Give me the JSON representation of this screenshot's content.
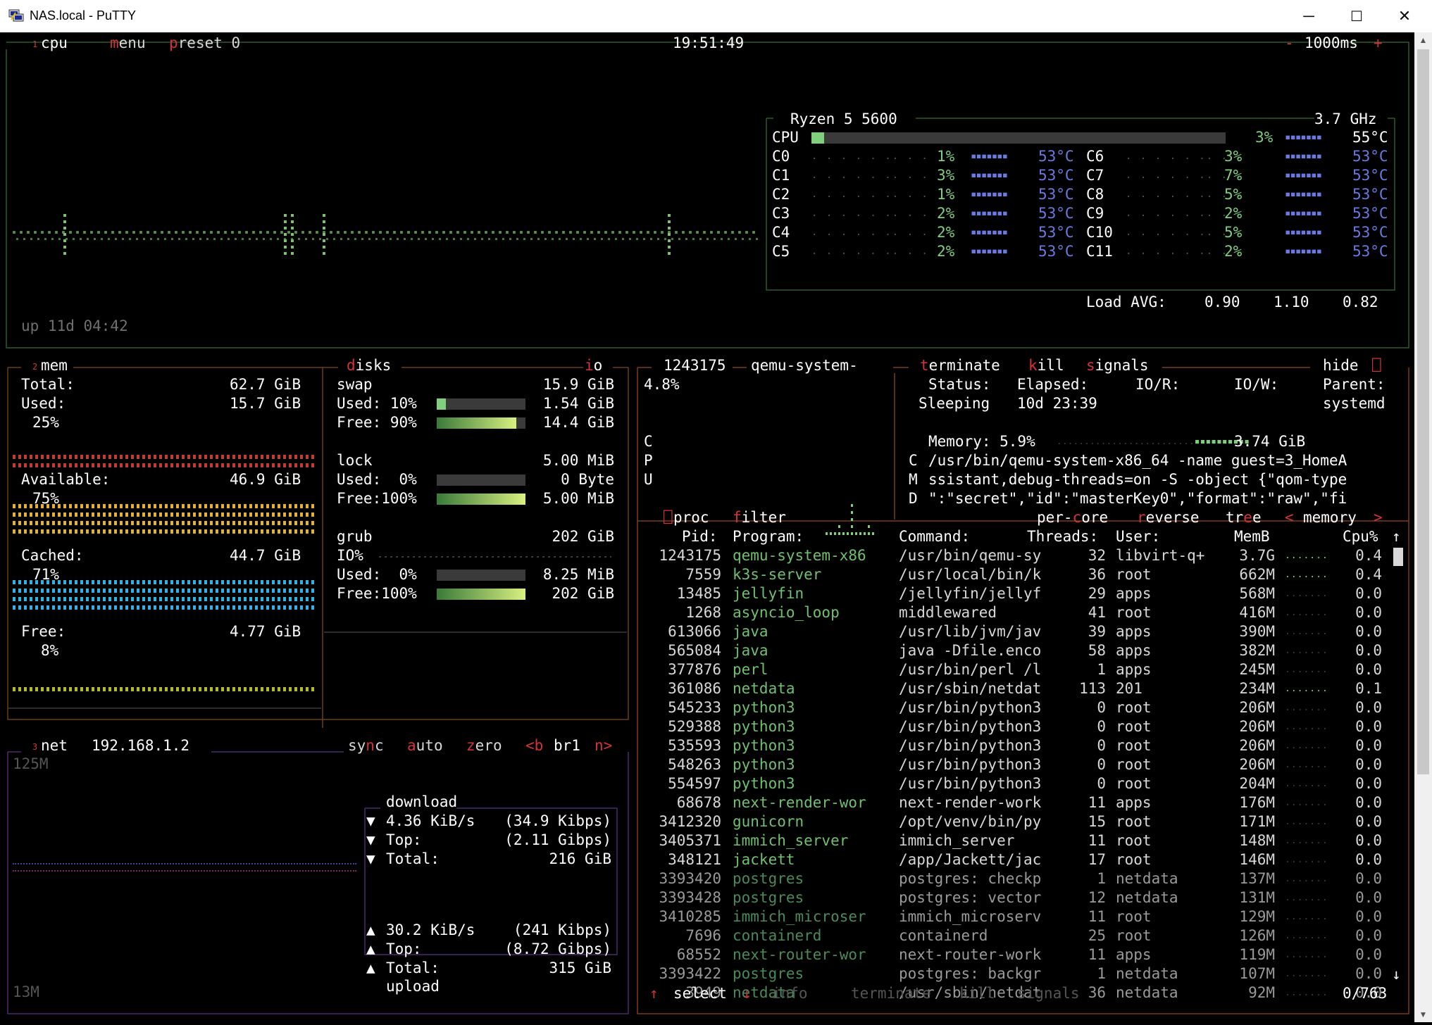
{
  "window": {
    "title": "NAS.local - PuTTY",
    "minimize": "─",
    "maximize": "☐",
    "close": "✕"
  },
  "cpu_box": {
    "num": "1",
    "tab": "cpu",
    "menu": "menu",
    "preset": "preset 0",
    "clock": "19:51:49",
    "minus": "-",
    "interval": "1000ms",
    "plus": "+",
    "uptime": "up 11d 04:42",
    "model": "Ryzen 5 5600",
    "freq": "3.7 GHz",
    "total": {
      "label": "CPU",
      "usage_fraction": 0.03,
      "pct": "3%",
      "temp": "55°C"
    },
    "cores": [
      {
        "label": "C0",
        "pct": "1%",
        "temp": "53°C"
      },
      {
        "label": "C1",
        "pct": "3%",
        "temp": "53°C"
      },
      {
        "label": "C2",
        "pct": "1%",
        "temp": "53°C"
      },
      {
        "label": "C3",
        "pct": "2%",
        "temp": "53°C"
      },
      {
        "label": "C4",
        "pct": "2%",
        "temp": "53°C"
      },
      {
        "label": "C5",
        "pct": "2%",
        "temp": "53°C"
      },
      {
        "label": "C6",
        "pct": "3%",
        "temp": "53°C"
      },
      {
        "label": "C7",
        "pct": "7%",
        "temp": "53°C"
      },
      {
        "label": "C8",
        "pct": "5%",
        "temp": "53°C"
      },
      {
        "label": "C9",
        "pct": "2%",
        "temp": "53°C"
      },
      {
        "label": "C10",
        "pct": "5%",
        "temp": "53°C"
      },
      {
        "label": "C11",
        "pct": "2%",
        "temp": "53°C"
      }
    ],
    "load_label": "Load AVG:",
    "load": [
      "0.90",
      "1.10",
      "0.82"
    ]
  },
  "mem_box": {
    "num": "2",
    "tab": "mem",
    "total_label": "Total:",
    "total": "62.7 GiB",
    "used_label": "Used:",
    "used": "15.7 GiB",
    "used_pct": "25%",
    "avail_label": "Available:",
    "avail": "46.9 GiB",
    "avail_pct": "75%",
    "cached_label": "Cached:",
    "cached": "44.7 GiB",
    "cached_pct": "71%",
    "free_label": "Free:",
    "free": "4.77 GiB",
    "free_pct": "8%"
  },
  "disks_box": {
    "tab": "disks",
    "io_tab": "io",
    "disks": [
      {
        "name": "swap",
        "size": "15.9 GiB",
        "used_label": "Used: 10%",
        "used": "1.54 GiB",
        "used_fraction": 0.1,
        "free_label": "Free: 90%",
        "free": "14.4 GiB",
        "free_fraction": 0.9
      },
      {
        "name": "lock",
        "size": "5.00 MiB",
        "used_label": "Used:  0%",
        "used": "0 Byte",
        "used_fraction": 0.0,
        "free_label": "Free:100%",
        "free": "5.00 MiB",
        "free_fraction": 1.0
      },
      {
        "name": "grub",
        "size": "202 GiB",
        "io_label": "IO%",
        "used_label": "Used:  0%",
        "used": "8.25 MiB",
        "used_fraction": 0.0,
        "free_label": "Free:100%",
        "free": "202 GiB",
        "free_fraction": 1.0
      }
    ]
  },
  "net_box": {
    "num": "3",
    "tab": "net",
    "ip": "192.168.1.2",
    "sync": "sync",
    "auto": "auto",
    "zero": "zero",
    "b_key": "<b",
    "iface": "br1",
    "n_key": "n>",
    "scale_top": "125M",
    "scale_bottom": "13M",
    "download_title": "download",
    "upload_title": "upload",
    "download": [
      {
        "icon": "▼",
        "label": "4.36 KiB/s",
        "value": "(34.9 Kibps)"
      },
      {
        "icon": "▼",
        "label": "Top:",
        "value": "(2.11 Gibps)"
      },
      {
        "icon": "▼",
        "label": "Total:",
        "value": "216 GiB"
      }
    ],
    "upload": [
      {
        "icon": "▲",
        "label": "30.2 KiB/s",
        "value": "(241 Kibps)"
      },
      {
        "icon": "▲",
        "label": "Top:",
        "value": "(8.72 Gibps)"
      },
      {
        "icon": "▲",
        "label": "Total:",
        "value": "315 GiB"
      }
    ]
  },
  "detail_box": {
    "pid": "1243175",
    "name": "qemu-system-",
    "terminate": "terminate",
    "kill": "kill",
    "signals": "signals",
    "hide": "hide",
    "cpu_pct": "4.8%",
    "cpu_vlabel": [
      "C",
      "P",
      "U"
    ],
    "status_label": "Status:",
    "status": "Sleeping",
    "elapsed_label": "Elapsed:",
    "elapsed": "10d 23:39",
    "ior_label": "IO/R:",
    "iow_label": "IO/W:",
    "parent_label": "Parent:",
    "parent": "systemd",
    "memory_label": "Memory: 5.9%",
    "memory": "3.74 GiB",
    "cmd_vlabel": [
      "C",
      "M",
      "D"
    ],
    "cmd_lines": [
      "/usr/bin/qemu-system-x86_64 -name guest=3_HomeA",
      "ssistant,debug-threads=on -S -object {\"qom-type",
      "\":\"secret\",\"id\":\"masterKey0\",\"format\":\"raw\",\"fi"
    ]
  },
  "proc_box": {
    "tab": "proc",
    "filter": "filter",
    "per_core": "per-core",
    "reverse": "reverse",
    "tree": "tree",
    "sort": "memory",
    "sort_left": "<",
    "sort_right": ">",
    "headers": {
      "pid": "Pid:",
      "program": "Program:",
      "command": "Command:",
      "threads": "Threads:",
      "user": "User:",
      "memb": "MemB",
      "cpu": "Cpu%"
    },
    "rows": [
      {
        "pid": "1243175",
        "program": "qemu-system-x86",
        "command": "/usr/bin/qemu-sy",
        "threads": "32",
        "user": "libvirt-q+",
        "mem": "3.7G",
        "cpu": "0.4"
      },
      {
        "pid": "7559",
        "program": "k3s-server",
        "command": "/usr/local/bin/k",
        "threads": "36",
        "user": "root",
        "mem": "662M",
        "cpu": "0.4"
      },
      {
        "pid": "13485",
        "program": "jellyfin",
        "command": "/jellyfin/jellyf",
        "threads": "29",
        "user": "apps",
        "mem": "568M",
        "cpu": "0.0"
      },
      {
        "pid": "1268",
        "program": "asyncio_loop",
        "command": "middlewared",
        "threads": "41",
        "user": "root",
        "mem": "416M",
        "cpu": "0.0"
      },
      {
        "pid": "613066",
        "program": "java",
        "command": "/usr/lib/jvm/jav",
        "threads": "39",
        "user": "apps",
        "mem": "390M",
        "cpu": "0.0"
      },
      {
        "pid": "565084",
        "program": "java",
        "command": "java -Dfile.enco",
        "threads": "58",
        "user": "apps",
        "mem": "382M",
        "cpu": "0.0"
      },
      {
        "pid": "377876",
        "program": "perl",
        "command": "/usr/bin/perl /l",
        "threads": "1",
        "user": "apps",
        "mem": "245M",
        "cpu": "0.0"
      },
      {
        "pid": "361086",
        "program": "netdata",
        "command": "/usr/sbin/netdat",
        "threads": "113",
        "user": "201",
        "mem": "234M",
        "cpu": "0.1"
      },
      {
        "pid": "545233",
        "program": "python3",
        "command": "/usr/bin/python3",
        "threads": "0",
        "user": "root",
        "mem": "206M",
        "cpu": "0.0"
      },
      {
        "pid": "529388",
        "program": "python3",
        "command": "/usr/bin/python3",
        "threads": "0",
        "user": "root",
        "mem": "206M",
        "cpu": "0.0"
      },
      {
        "pid": "535593",
        "program": "python3",
        "command": "/usr/bin/python3",
        "threads": "0",
        "user": "root",
        "mem": "206M",
        "cpu": "0.0"
      },
      {
        "pid": "548263",
        "program": "python3",
        "command": "/usr/bin/python3",
        "threads": "0",
        "user": "root",
        "mem": "206M",
        "cpu": "0.0"
      },
      {
        "pid": "554597",
        "program": "python3",
        "command": "/usr/bin/python3",
        "threads": "0",
        "user": "root",
        "mem": "204M",
        "cpu": "0.0"
      },
      {
        "pid": "68678",
        "program": "next-render-wor",
        "command": "next-render-work",
        "threads": "11",
        "user": "apps",
        "mem": "176M",
        "cpu": "0.0"
      },
      {
        "pid": "3412320",
        "program": "gunicorn",
        "command": "/opt/venv/bin/py",
        "threads": "15",
        "user": "root",
        "mem": "171M",
        "cpu": "0.0"
      },
      {
        "pid": "3405371",
        "program": "immich_server",
        "command": "immich_server",
        "threads": "11",
        "user": "root",
        "mem": "148M",
        "cpu": "0.0"
      },
      {
        "pid": "348121",
        "program": "jackett",
        "command": "/app/Jackett/jac",
        "threads": "17",
        "user": "root",
        "mem": "146M",
        "cpu": "0.0"
      },
      {
        "pid": "3393420",
        "program": "postgres",
        "command": "postgres: checkp",
        "threads": "1",
        "user": "netdata",
        "mem": "137M",
        "cpu": "0.0"
      },
      {
        "pid": "3393428",
        "program": "postgres",
        "command": "postgres: vector",
        "threads": "12",
        "user": "netdata",
        "mem": "131M",
        "cpu": "0.0"
      },
      {
        "pid": "3410285",
        "program": "immich_microser",
        "command": "immich_microserv",
        "threads": "11",
        "user": "root",
        "mem": "129M",
        "cpu": "0.0"
      },
      {
        "pid": "7696",
        "program": "containerd",
        "command": "containerd",
        "threads": "25",
        "user": "root",
        "mem": "126M",
        "cpu": "0.0"
      },
      {
        "pid": "68552",
        "program": "next-router-wor",
        "command": "next-router-work",
        "threads": "11",
        "user": "apps",
        "mem": "119M",
        "cpu": "0.0"
      },
      {
        "pid": "3393422",
        "program": "postgres",
        "command": "postgres: backgr",
        "threads": "1",
        "user": "netdata",
        "mem": "107M",
        "cpu": "0.0"
      },
      {
        "pid": "3949",
        "program": "netdata",
        "command": "/usr/sbin/netdat",
        "threads": "36",
        "user": "netdata",
        "mem": "92M",
        "cpu": "0.0"
      }
    ],
    "footer": {
      "up": "↑",
      "select": "select",
      "down": "↓",
      "info": "info",
      "terminate": "terminate",
      "kill": "kill",
      "signals": "signals",
      "count": "0/763"
    },
    "scroll_up": "↑",
    "scroll_down": "↓"
  },
  "colors": {
    "cpu_box": "#2f5a2a",
    "mem_box": "#6b3e12",
    "net_box": "#4b2a6e",
    "proc_box": "#7a3a1a",
    "hotkey": "#d33434",
    "green_text": "#70c070",
    "blue_temp": "#6a7ae0",
    "mem_red": "#c23a3a",
    "mem_yellow": "#e0b040",
    "mem_cyan": "#3ab0e0",
    "mem_free": "#b8b830"
  }
}
